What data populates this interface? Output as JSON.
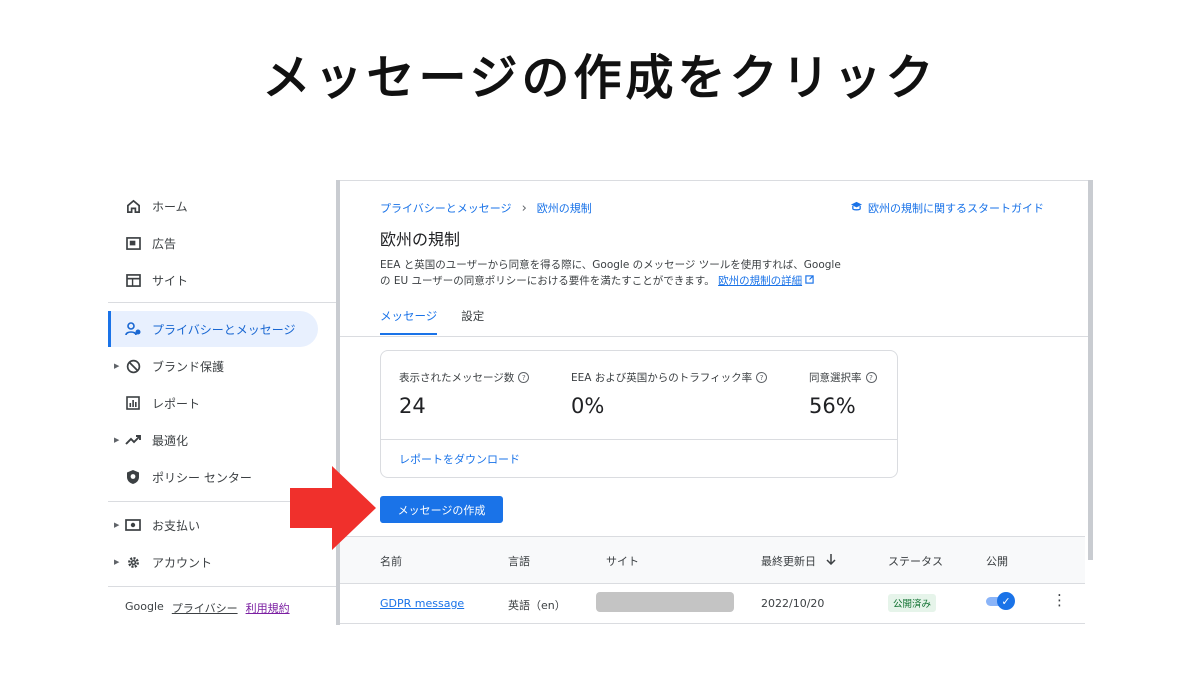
{
  "headline": "メッセージの作成をクリック",
  "sidebar": {
    "items": [
      {
        "label": "ホーム",
        "icon": "home-icon"
      },
      {
        "label": "広告",
        "icon": "ad-icon"
      },
      {
        "label": "サイト",
        "icon": "browser-icon"
      },
      {
        "label": "プライバシーとメッセージ",
        "icon": "privacy-user-icon",
        "active": true
      },
      {
        "label": "ブランド保護",
        "icon": "block-icon",
        "expandable": true
      },
      {
        "label": "レポート",
        "icon": "report-chart-icon"
      },
      {
        "label": "最適化",
        "icon": "trending-up-icon",
        "expandable": true
      },
      {
        "label": "ポリシー センター",
        "icon": "shield-icon"
      },
      {
        "label": "お支払い",
        "icon": "payment-icon",
        "expandable": true
      },
      {
        "label": "アカウント",
        "icon": "gear-icon",
        "expandable": true
      }
    ],
    "footer": {
      "brand": "Google",
      "privacy": "プライバシー",
      "terms": "利用規約"
    }
  },
  "breadcrumb": {
    "parent": "プライバシーとメッセージ",
    "current": "欧州の規制"
  },
  "guide_link": "欧州の規制に関するスタートガイド",
  "page_title": "欧州の規制",
  "description": {
    "line1": "EEA と英国のユーザーから同意を得る際に、Google のメッセージ ツールを使用すれば、Google",
    "line2": "の EU ユーザーの同意ポリシーにおける要件を満たすことができます。",
    "link": "欧州の規制の詳細"
  },
  "tabs": [
    {
      "label": "メッセージ",
      "active": true
    },
    {
      "label": "設定",
      "active": false
    }
  ],
  "stats": [
    {
      "label": "表示されたメッセージ数",
      "value": "24"
    },
    {
      "label": "EEA および英国からのトラフィック率",
      "value": "0%"
    },
    {
      "label": "同意選択率",
      "value": "56%"
    }
  ],
  "download_link": "レポートをダウンロード",
  "create_button": "メッセージの作成",
  "table": {
    "headers": {
      "name": "名前",
      "language": "言語",
      "site": "サイト",
      "updated": "最終更新日",
      "status": "ステータス",
      "publish": "公開"
    },
    "rows": [
      {
        "name": "GDPR message",
        "language": "英語（en）",
        "updated": "2022/10/20",
        "status": "公開済み",
        "published": true
      }
    ]
  },
  "colors": {
    "accent": "#1a73e8",
    "arrow": "#f0302c",
    "active_bg": "#e8f0fe"
  }
}
